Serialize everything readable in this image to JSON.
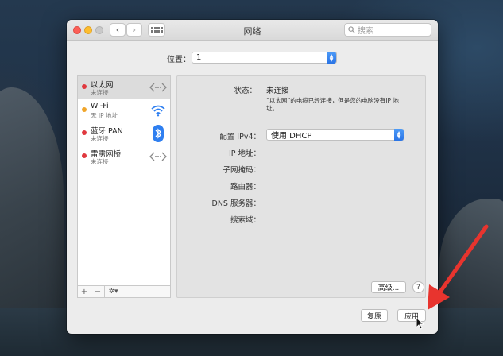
{
  "window": {
    "title": "网络",
    "search_placeholder": "搜索"
  },
  "location": {
    "label": "位置：",
    "value": "1"
  },
  "services": [
    {
      "name": "以太网",
      "status": "未连接",
      "status_color": "#e0383e",
      "icon": "ethernet-arrows-icon",
      "selected": true
    },
    {
      "name": "Wi-Fi",
      "status": "无 IP 地址",
      "status_color": "#f0a52a",
      "icon": "wifi-icon",
      "selected": false
    },
    {
      "name": "蓝牙 PAN",
      "status": "未连接",
      "status_color": "#e0383e",
      "icon": "bluetooth-icon",
      "selected": false
    },
    {
      "name": "雷雳网桥",
      "status": "未连接",
      "status_color": "#e0383e",
      "icon": "thunderbolt-bridge-arrows-icon",
      "selected": false
    }
  ],
  "sidebar_tools": {
    "add": "+",
    "remove": "−",
    "gear": "✲▾"
  },
  "detail": {
    "status_label": "状态：",
    "status_value": "未连接",
    "status_description": "“以太网”的电缆已经连接，但是您的电脑没有IP 地址。",
    "ipv4_label": "配置 IPv4：",
    "ipv4_value": "使用 DHCP",
    "fields": [
      {
        "label": "IP 地址："
      },
      {
        "label": "子网掩码："
      },
      {
        "label": "路由器："
      },
      {
        "label": "DNS 服务器："
      },
      {
        "label": "搜索域："
      }
    ],
    "advanced_label": "高级...",
    "help_label": "?"
  },
  "buttons": {
    "revert": "复原",
    "apply": "应用"
  },
  "colors": {
    "accent": "#2f7ff0",
    "annotation_arrow": "#e8342e"
  }
}
